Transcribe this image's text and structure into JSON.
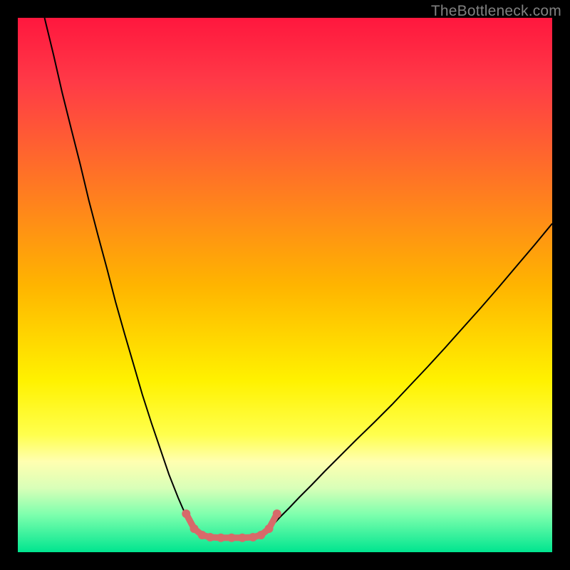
{
  "watermark": "TheBottleneck.com",
  "chart_data": {
    "type": "line",
    "title": "",
    "xlabel": "",
    "ylabel": "",
    "xlim": [
      0,
      100
    ],
    "ylim": [
      0,
      100
    ],
    "background_gradient": {
      "stops": [
        {
          "offset": 0.0,
          "color": "#ff173e"
        },
        {
          "offset": 0.12,
          "color": "#ff3a47"
        },
        {
          "offset": 0.5,
          "color": "#ffb400"
        },
        {
          "offset": 0.68,
          "color": "#fff200"
        },
        {
          "offset": 0.78,
          "color": "#ffff4d"
        },
        {
          "offset": 0.83,
          "color": "#ffffb0"
        },
        {
          "offset": 0.88,
          "color": "#d9ffb8"
        },
        {
          "offset": 0.93,
          "color": "#7dffad"
        },
        {
          "offset": 1.0,
          "color": "#00e58f"
        }
      ]
    },
    "series": [
      {
        "name": "left-curve",
        "color": "#000000",
        "width": 2,
        "x": [
          5.0,
          6.7,
          8.3,
          10.0,
          11.7,
          13.3,
          15.0,
          16.7,
          18.3,
          20.0,
          21.7,
          23.3,
          25.0,
          26.7,
          28.3,
          30.0,
          31.0,
          32.0,
          33.0,
          33.5
        ],
        "y": [
          100.0,
          93.0,
          86.0,
          79.2,
          72.5,
          65.8,
          59.3,
          53.0,
          46.8,
          40.8,
          35.0,
          29.5,
          24.2,
          19.2,
          14.5,
          10.2,
          7.9,
          6.0,
          4.5,
          4.0
        ]
      },
      {
        "name": "right-curve",
        "color": "#000000",
        "width": 2,
        "x": [
          46.5,
          47.0,
          48.0,
          49.2,
          50.8,
          52.7,
          55.0,
          57.5,
          60.3,
          63.3,
          66.7,
          70.0,
          73.3,
          76.7,
          80.0,
          83.3,
          86.7,
          90.0,
          93.3,
          96.7,
          100.0
        ],
        "y": [
          4.0,
          4.5,
          5.4,
          6.7,
          8.3,
          10.3,
          12.6,
          15.2,
          18.0,
          21.0,
          24.3,
          27.6,
          31.1,
          34.7,
          38.3,
          42.0,
          45.8,
          49.6,
          53.5,
          57.5,
          61.5
        ]
      },
      {
        "name": "bottom-flat",
        "color": "#d76a6a",
        "width": 9,
        "cap": "round",
        "x": [
          31.5,
          33.0,
          34.5,
          36.0,
          38.0,
          40.0,
          42.0,
          44.0,
          45.5,
          47.0,
          48.5
        ],
        "y": [
          7.2,
          4.4,
          3.2,
          2.8,
          2.7,
          2.7,
          2.7,
          2.8,
          3.2,
          4.4,
          7.2
        ]
      },
      {
        "name": "bottom-dots",
        "type": "scatter",
        "color": "#d76a6a",
        "radius": 6,
        "x": [
          31.5,
          33.0,
          34.5,
          36.0,
          38.0,
          40.0,
          42.0,
          44.0,
          45.5,
          47.0,
          48.5
        ],
        "y": [
          7.2,
          4.4,
          3.2,
          2.8,
          2.7,
          2.7,
          2.7,
          2.8,
          3.2,
          4.4,
          7.2
        ]
      }
    ]
  }
}
